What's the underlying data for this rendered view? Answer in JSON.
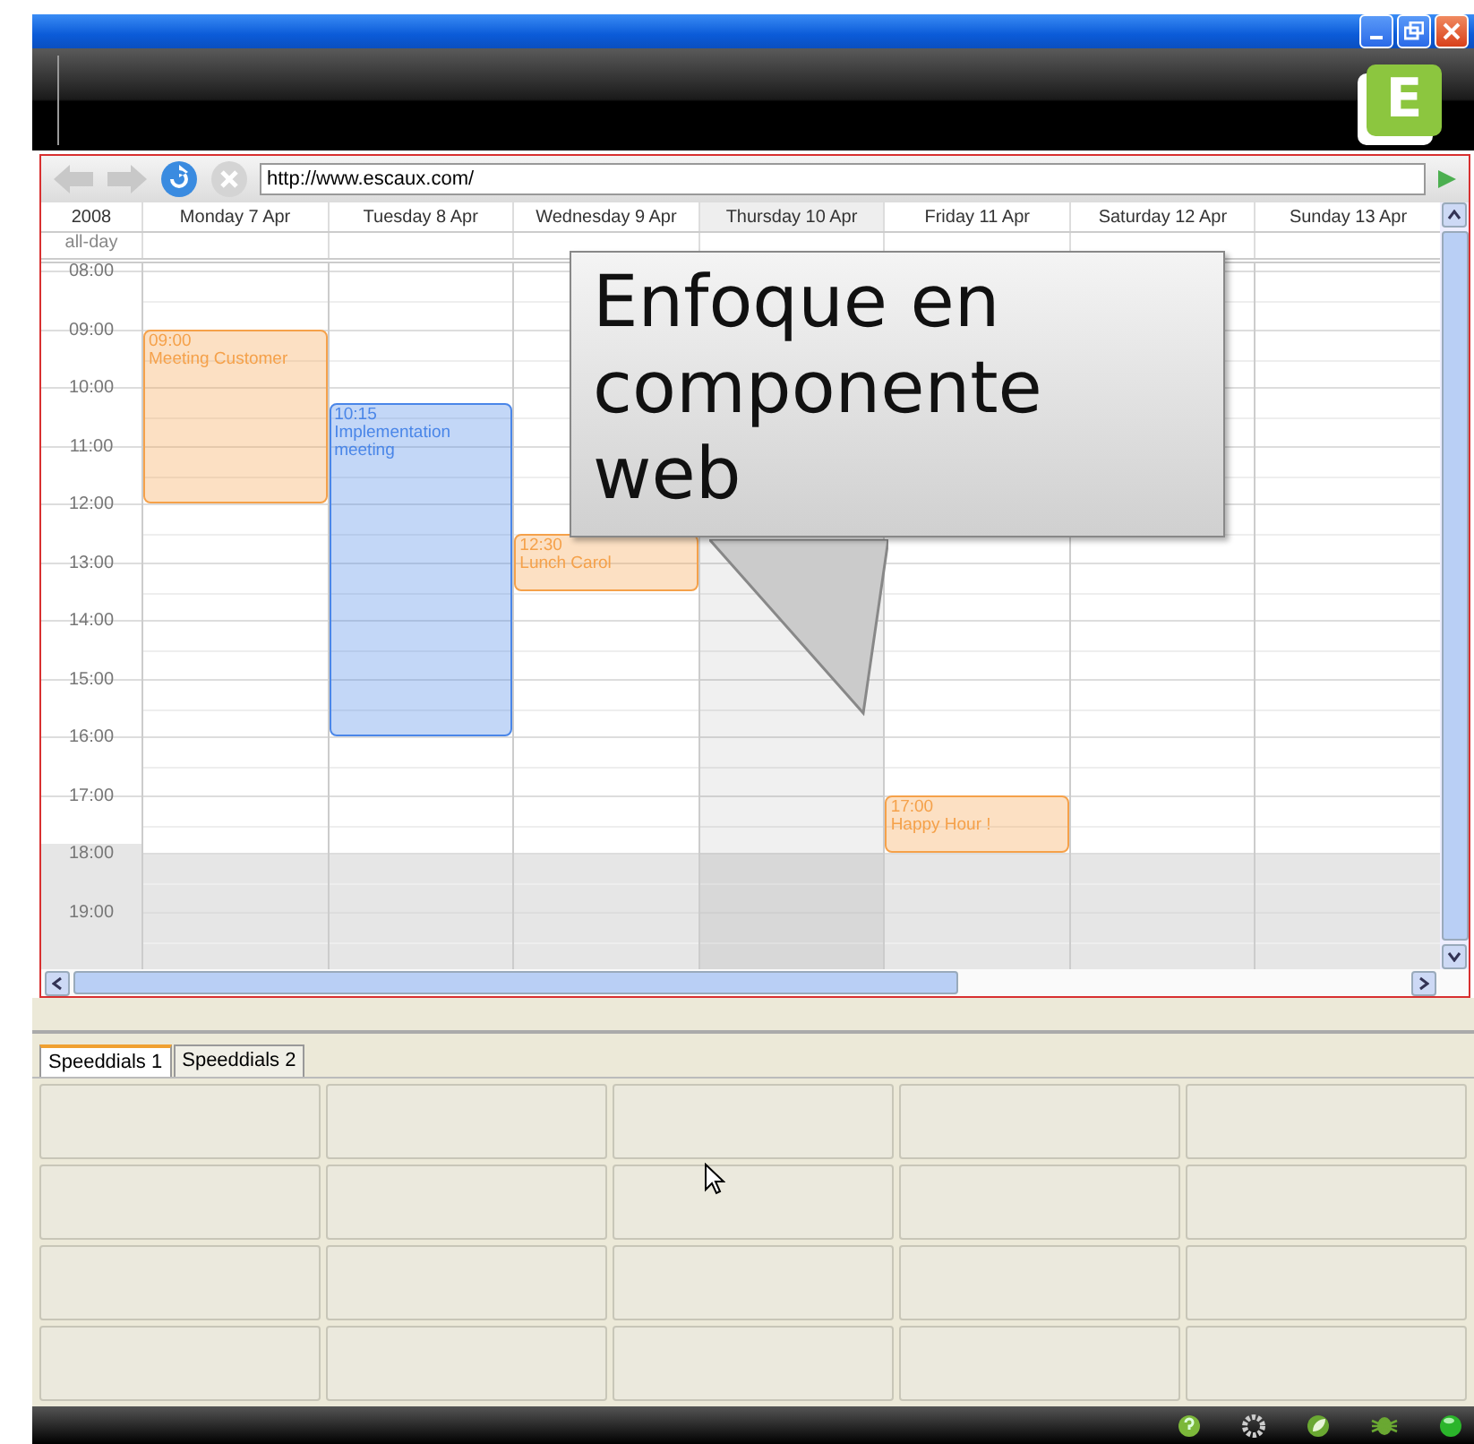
{
  "window": {
    "buttons": [
      {
        "kind": "minimize"
      },
      {
        "kind": "restore"
      },
      {
        "kind": "close"
      }
    ]
  },
  "header": {
    "logo": "E"
  },
  "browser": {
    "url": "http://www.escaux.com/"
  },
  "calendar": {
    "year": "2008",
    "allday_label": "all-day",
    "days": [
      {
        "label": "Monday 7 Apr",
        "today": false,
        "events": [
          {
            "time": "09:00",
            "title": "Meeting Customer",
            "color": "#f5a14a",
            "kind": "long"
          }
        ]
      },
      {
        "label": "Tuesday 8 Apr",
        "today": false,
        "events": [
          {
            "time": "10:15",
            "title": "Implementation meeting",
            "color": "#4a86e8",
            "kind": "extended"
          }
        ]
      },
      {
        "label": "Wednesday 9 Apr",
        "today": false,
        "events": [
          {
            "time": "12:30",
            "title": "Lunch Carol",
            "color": "#f5a14a",
            "kind": "short"
          }
        ]
      },
      {
        "label": "Thursday 10 Apr",
        "today": true
      },
      {
        "label": "Friday 11 Apr",
        "today": false,
        "events": [
          {
            "time": "17:00",
            "title": "Happy Hour !",
            "color": "#f5a14a",
            "kind": "short"
          }
        ]
      },
      {
        "label": "Saturday 12 Apr",
        "today": false
      },
      {
        "label": "Sunday 13 Apr",
        "today": false
      }
    ],
    "hours": [
      {
        "label": "08:00",
        "off_hours": false
      },
      {
        "label": "09:00",
        "off_hours": false
      },
      {
        "label": "10:00",
        "off_hours": false
      },
      {
        "label": "11:00",
        "off_hours": false
      },
      {
        "label": "12:00",
        "off_hours": false
      },
      {
        "label": "13:00",
        "off_hours": false
      },
      {
        "label": "14:00",
        "off_hours": false
      },
      {
        "label": "15:00",
        "off_hours": false
      },
      {
        "label": "16:00",
        "off_hours": false
      },
      {
        "label": "17:00",
        "off_hours": false
      },
      {
        "label": "18:00",
        "off_hours": true
      },
      {
        "label": "19:00",
        "off_hours": true
      }
    ]
  },
  "callout": {
    "text": "Enfoque en componente web"
  },
  "speeddial_tabs": [
    {
      "label": "Speeddials 1",
      "selected": true
    },
    {
      "label": "Speeddials 2",
      "selected": false
    }
  ]
}
